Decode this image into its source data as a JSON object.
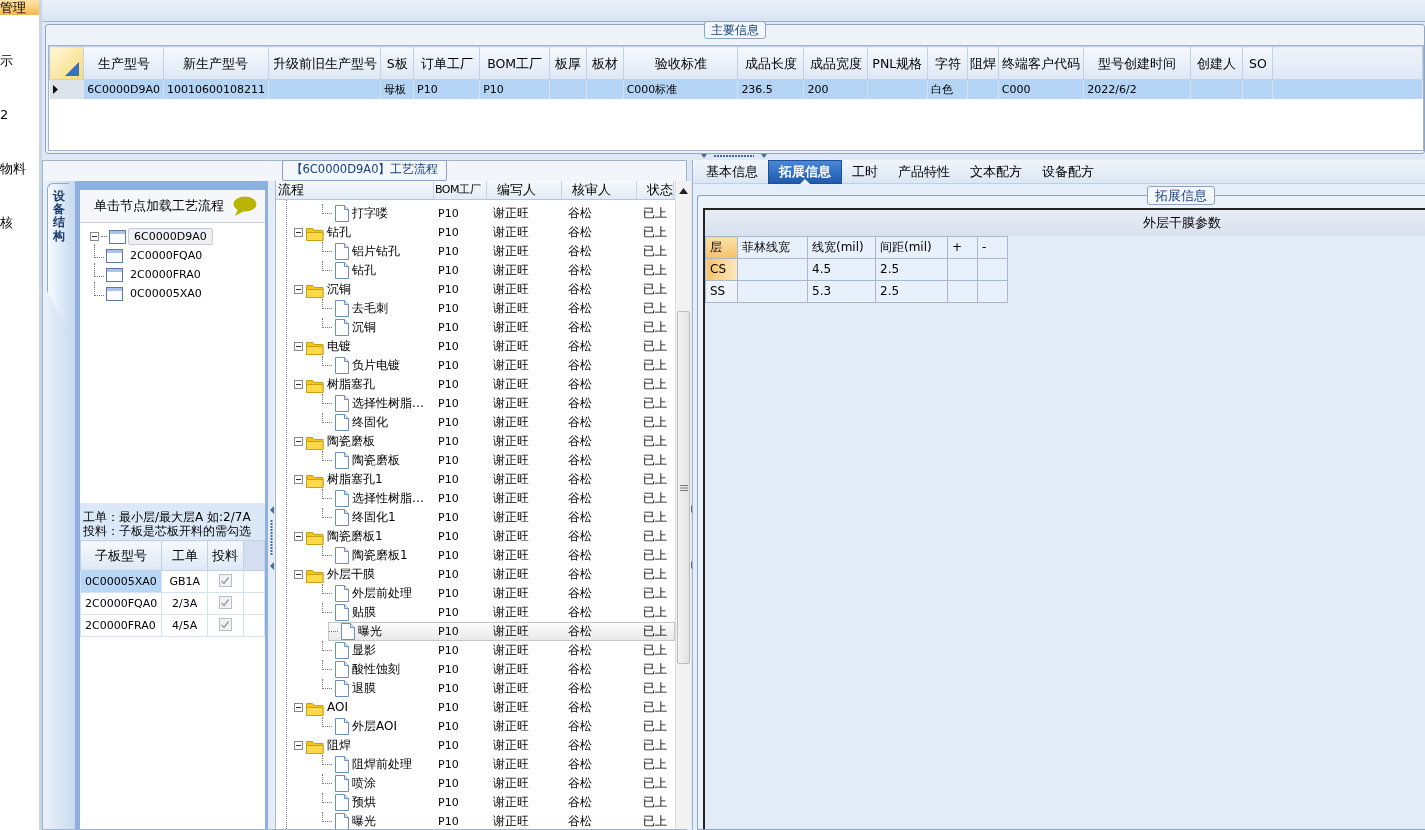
{
  "sidebar": {
    "items": [
      {
        "label": "管理",
        "selected": true
      },
      {
        "label": "示",
        "selected": false
      },
      {
        "label": "2",
        "selected": false
      },
      {
        "label": "物料",
        "selected": false
      },
      {
        "label": "核",
        "selected": false
      }
    ]
  },
  "main_info": {
    "title": "主要信息",
    "columns": [
      "生产型号",
      "新生产型号",
      "升级前旧生产型号",
      "S板",
      "订单工厂",
      "BOM工厂",
      "板厚",
      "板材",
      "验收标准",
      "成品长度",
      "成品宽度",
      "PNL规格",
      "字符",
      "阻焊",
      "终端客户代码",
      "型号创建时间",
      "创建人",
      "SO"
    ],
    "rows": [
      {
        "selected": true,
        "cells": [
          "6C0000D9A0",
          "10010600108211",
          null,
          "母板",
          "P10",
          "P10",
          null,
          null,
          "C000标准",
          "236.5",
          "200",
          null,
          "白色",
          null,
          "C000",
          "2022/6/2",
          null,
          null
        ]
      }
    ]
  },
  "process_panel": {
    "title": "【6C0000D9A0】工艺流程",
    "side_tab": "设备结构",
    "tree_header": "单击节点加载工艺流程",
    "tree": [
      {
        "label": "6C0000D9A0",
        "expanded": true,
        "selected": true,
        "children": [
          {
            "label": "2C0000FQA0",
            "selected": false
          },
          {
            "label": "2C0000FRA0",
            "selected": false
          },
          {
            "label": "0C00005XA0",
            "selected": false
          }
        ]
      }
    ],
    "note_lines": [
      "工单：最小层/最大层A 如:2/7A",
      "投料：子板是芯板开料的需勾选"
    ],
    "sub_boards": {
      "columns": [
        "子板型号",
        "工单",
        "投料"
      ],
      "rows": [
        {
          "cells": [
            "0C00005XA0",
            "GB1A"
          ],
          "checked": true,
          "selected": true
        },
        {
          "cells": [
            "2C0000FQA0",
            "2/3A"
          ],
          "checked": true,
          "selected": false
        },
        {
          "cells": [
            "2C0000FRA0",
            "4/5A"
          ],
          "checked": true,
          "selected": false
        }
      ]
    },
    "steps": {
      "columns": [
        "流程",
        "BOM工厂",
        "编写人",
        "核审人",
        "状态"
      ],
      "rows": [
        {
          "kind": "file",
          "cells": [
            "打字喽",
            "P10",
            "谢正旺",
            "谷松",
            "已上"
          ],
          "selected": false
        },
        {
          "kind": "folder",
          "cells": [
            "钻孔",
            "P10",
            "谢正旺",
            "谷松",
            "已上"
          ],
          "selected": false,
          "expanded": true,
          "children": [
            {
              "kind": "file",
              "cells": [
                "铝片钻孔",
                "P10",
                "谢正旺",
                "谷松",
                "已上"
              ],
              "selected": false
            },
            {
              "kind": "file",
              "cells": [
                "钻孔",
                "P10",
                "谢正旺",
                "谷松",
                "已上"
              ],
              "selected": false
            }
          ]
        },
        {
          "kind": "folder",
          "cells": [
            "沉铜",
            "P10",
            "谢正旺",
            "谷松",
            "已上"
          ],
          "selected": false,
          "expanded": true,
          "children": [
            {
              "kind": "file",
              "cells": [
                "去毛刺",
                "P10",
                "谢正旺",
                "谷松",
                "已上"
              ],
              "selected": false
            },
            {
              "kind": "file",
              "cells": [
                "沉铜",
                "P10",
                "谢正旺",
                "谷松",
                "已上"
              ],
              "selected": false
            }
          ]
        },
        {
          "kind": "folder",
          "cells": [
            "电镀",
            "P10",
            "谢正旺",
            "谷松",
            "已上"
          ],
          "selected": false,
          "expanded": true,
          "children": [
            {
              "kind": "file",
              "cells": [
                "负片电镀",
                "P10",
                "谢正旺",
                "谷松",
                "已上"
              ],
              "selected": false
            }
          ]
        },
        {
          "kind": "folder",
          "cells": [
            "树脂塞孔",
            "P10",
            "谢正旺",
            "谷松",
            "已上"
          ],
          "selected": false,
          "expanded": true,
          "children": [
            {
              "kind": "file",
              "cells": [
                "选择性树脂…",
                "P10",
                "谢正旺",
                "谷松",
                "已上"
              ],
              "selected": false
            },
            {
              "kind": "file",
              "cells": [
                "终固化",
                "P10",
                "谢正旺",
                "谷松",
                "已上"
              ],
              "selected": false
            }
          ]
        },
        {
          "kind": "folder",
          "cells": [
            "陶瓷磨板",
            "P10",
            "谢正旺",
            "谷松",
            "已上"
          ],
          "selected": false,
          "expanded": true,
          "children": [
            {
              "kind": "file",
              "cells": [
                "陶瓷磨板",
                "P10",
                "谢正旺",
                "谷松",
                "已上"
              ],
              "selected": false
            }
          ]
        },
        {
          "kind": "folder",
          "cells": [
            "树脂塞孔1",
            "P10",
            "谢正旺",
            "谷松",
            "已上"
          ],
          "selected": false,
          "expanded": true,
          "children": [
            {
              "kind": "file",
              "cells": [
                "选择性树脂…",
                "P10",
                "谢正旺",
                "谷松",
                "已上"
              ],
              "selected": false
            },
            {
              "kind": "file",
              "cells": [
                "终固化1",
                "P10",
                "谢正旺",
                "谷松",
                "已上"
              ],
              "selected": false
            }
          ]
        },
        {
          "kind": "folder",
          "cells": [
            "陶瓷磨板1",
            "P10",
            "谢正旺",
            "谷松",
            "已上"
          ],
          "selected": false,
          "expanded": true,
          "children": [
            {
              "kind": "file",
              "cells": [
                "陶瓷磨板1",
                "P10",
                "谢正旺",
                "谷松",
                "已上"
              ],
              "selected": false
            }
          ]
        },
        {
          "kind": "folder",
          "cells": [
            "外层干膜",
            "P10",
            "谢正旺",
            "谷松",
            "已上"
          ],
          "selected": false,
          "expanded": true,
          "children": [
            {
              "kind": "file",
              "cells": [
                "外层前处理",
                "P10",
                "谢正旺",
                "谷松",
                "已上"
              ],
              "selected": false
            },
            {
              "kind": "file",
              "cells": [
                "贴膜",
                "P10",
                "谢正旺",
                "谷松",
                "已上"
              ],
              "selected": false
            },
            {
              "kind": "file",
              "cells": [
                "曝光",
                "P10",
                "谢正旺",
                "谷松",
                "已上"
              ],
              "selected": true
            },
            {
              "kind": "file",
              "cells": [
                "显影",
                "P10",
                "谢正旺",
                "谷松",
                "已上"
              ],
              "selected": false
            },
            {
              "kind": "file",
              "cells": [
                "酸性蚀刻",
                "P10",
                "谢正旺",
                "谷松",
                "已上"
              ],
              "selected": false
            },
            {
              "kind": "file",
              "cells": [
                "退膜",
                "P10",
                "谢正旺",
                "谷松",
                "已上"
              ],
              "selected": false
            }
          ]
        },
        {
          "kind": "folder",
          "cells": [
            "AOI",
            "P10",
            "谢正旺",
            "谷松",
            "已上"
          ],
          "selected": false,
          "expanded": true,
          "children": [
            {
              "kind": "file",
              "cells": [
                "外层AOI",
                "P10",
                "谢正旺",
                "谷松",
                "已上"
              ],
              "selected": false
            }
          ]
        },
        {
          "kind": "folder",
          "cells": [
            "阻焊",
            "P10",
            "谢正旺",
            "谷松",
            "已上"
          ],
          "selected": false,
          "expanded": true,
          "children": [
            {
              "kind": "file",
              "cells": [
                "阻焊前处理",
                "P10",
                "谢正旺",
                "谷松",
                "已上"
              ],
              "selected": false
            },
            {
              "kind": "file",
              "cells": [
                "喷涂",
                "P10",
                "谢正旺",
                "谷松",
                "已上"
              ],
              "selected": false
            },
            {
              "kind": "file",
              "cells": [
                "预烘",
                "P10",
                "谢正旺",
                "谷松",
                "已上"
              ],
              "selected": false
            },
            {
              "kind": "file",
              "cells": [
                "曝光",
                "P10",
                "谢正旺",
                "谷松",
                "已上"
              ],
              "selected": false
            }
          ]
        }
      ]
    }
  },
  "detail_panel": {
    "tabs": [
      {
        "label": "基本信息",
        "selected": false
      },
      {
        "label": "拓展信息",
        "selected": true
      },
      {
        "label": "工时",
        "selected": false
      },
      {
        "label": "产品特性",
        "selected": false
      },
      {
        "label": "文本配方",
        "selected": false
      },
      {
        "label": "设备配方",
        "selected": false
      }
    ],
    "group_title": "拓展信息",
    "param_table": {
      "title": "外层干膜参数",
      "columns": [
        "层",
        "菲林线宽",
        "线宽(mil)",
        "间距(mil)",
        "+",
        "-"
      ],
      "rows": [
        {
          "selected": true,
          "cells": [
            "CS",
            null,
            "4.5",
            "2.5",
            null,
            null
          ]
        },
        {
          "selected": false,
          "cells": [
            "SS",
            null,
            "5.3",
            "2.5",
            null,
            null
          ]
        }
      ]
    }
  }
}
